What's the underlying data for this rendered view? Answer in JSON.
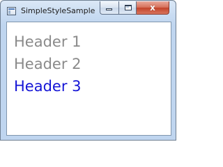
{
  "window": {
    "title": "SimpleStyleSample",
    "icon": "app-window-icon",
    "controls": {
      "minimize_icon": "minimize-icon",
      "maximize_icon": "maximize-icon",
      "close_label": "x"
    }
  },
  "content": {
    "headers": [
      {
        "label": "Header 1",
        "color": "#8a8a8a"
      },
      {
        "label": "Header 2",
        "color": "#8a8a8a"
      },
      {
        "label": "Header 3",
        "color": "#1515d6"
      }
    ]
  }
}
